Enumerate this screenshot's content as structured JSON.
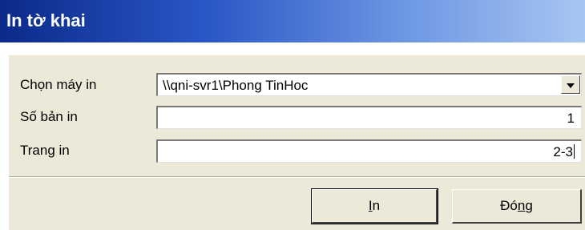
{
  "window": {
    "title": "In tờ khai"
  },
  "form": {
    "printer_label": "Chọn máy in",
    "printer_value": "\\\\qni-svr1\\Phong TinHoc",
    "copies_label": "Số bản in",
    "copies_value": "1",
    "pages_label": "Trang in",
    "pages_value": "2-3"
  },
  "buttons": {
    "print_pre": "",
    "print_key": "I",
    "print_post": "n",
    "close_pre": "Đó",
    "close_key": "n",
    "close_post": "g"
  }
}
